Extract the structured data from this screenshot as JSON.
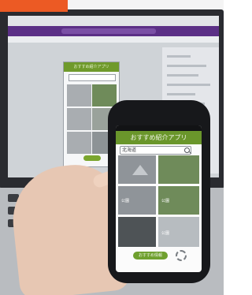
{
  "phone_app": {
    "title": "おすすめ紹介アプリ",
    "search": {
      "value": "北海道"
    },
    "tiles": [
      {
        "line1": "公園",
        "line2": ""
      },
      {
        "line1": "公園",
        "line2": ""
      },
      {
        "line1": "",
        "line2": ""
      },
      {
        "line1": "",
        "line2": ""
      },
      {
        "line1": "公園",
        "line2": ""
      },
      {
        "line1": "",
        "line2": ""
      }
    ],
    "bottom_button": "おすすめ情報"
  },
  "laptop_preview": {
    "title": "おすすめ紹介アプリ"
  },
  "colors": {
    "app_green": "#6a962b",
    "editor_purple": "#5b2f86",
    "badge_orange": "#ec5a24"
  },
  "icons": [
    "search-icon",
    "mountain-icon",
    "reload-icon"
  ]
}
